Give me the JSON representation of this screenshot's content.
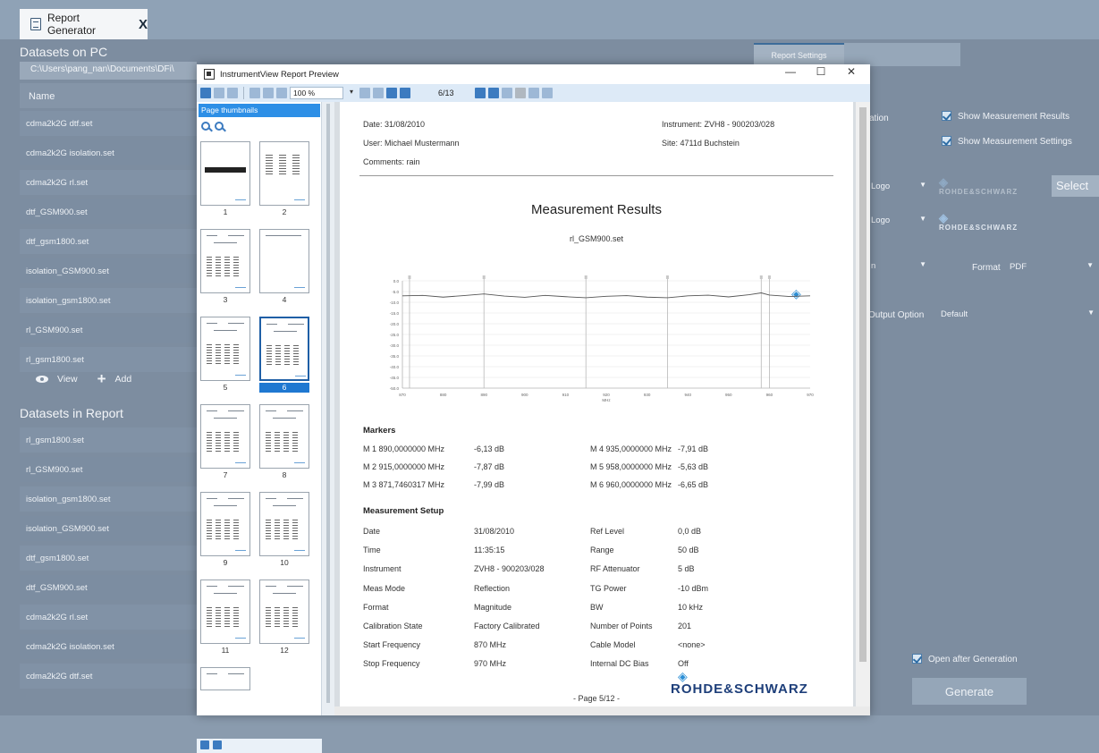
{
  "app": {
    "tab_title": "Report Generator",
    "tab_close": "X"
  },
  "left": {
    "datasets_pc_title": "Datasets on PC",
    "path": "C:\\Users\\pang_nan\\Documents\\DFi\\",
    "name_header": "Name",
    "pc_items": [
      "cdma2k2G dtf.set",
      "cdma2k2G isolation.set",
      "cdma2k2G rl.set",
      "dtf_GSM900.set",
      "dtf_gsm1800.set",
      "isolation_GSM900.set",
      "isolation_gsm1800.set",
      "rl_GSM900.set",
      "rl_gsm1800.set"
    ],
    "view_label": "View",
    "add_label": "Add",
    "datasets_report_title": "Datasets in Report",
    "report_items": [
      "rl_gsm1800.set",
      "rl_GSM900.set",
      "isolation_gsm1800.set",
      "isolation_GSM900.set",
      "dtf_gsm1800.set",
      "dtf_GSM900.set",
      "cdma2k2G rl.set",
      "cdma2k2G isolation.set",
      "cdma2k2G dtf.set"
    ]
  },
  "right": {
    "tab_label": "Report Settings",
    "partial_label": "ation",
    "show_results": "Show Measurement Results",
    "show_settings": "Show Measurement Settings",
    "logo_select_1": "Logo",
    "logo_select_2": "Logo",
    "select_button": "Select",
    "select_3": "n",
    "format_label": "Format",
    "format_value": "PDF",
    "output_option_label": "Output Option",
    "output_option_value": "Default",
    "open_after": "Open after Generation",
    "generate": "Generate",
    "rs_logo_text": "ROHDE&SCHWARZ"
  },
  "dialog": {
    "title": "InstrumentView Report Preview",
    "min": "—",
    "max": "☐",
    "close": "✕",
    "zoom": "100 %",
    "page_counter": "6/13",
    "thumb_header": "Page thumbnails",
    "thumb_numbers": [
      "1",
      "2",
      "3",
      "4",
      "5",
      "6",
      "7",
      "8",
      "9",
      "10",
      "11",
      "12"
    ]
  },
  "page": {
    "date": "Date: 31/08/2010",
    "user": "User: Michael Mustermann",
    "comments": "Comments: rain",
    "instrument": "Instrument: ZVH8 - 900203/028",
    "site": "Site: 4711d Buchstein",
    "title": "Measurement Results",
    "subtitle": "rl_GSM900.set",
    "markers_title": "Markers",
    "markers": [
      [
        "M 1 890,0000000 MHz",
        "-6,13 dB",
        "M 4 935,0000000 MHz",
        "-7,91 dB"
      ],
      [
        "M 2 915,0000000 MHz",
        "-7,87 dB",
        "M 5 958,0000000 MHz",
        "-5,63 dB"
      ],
      [
        "M 3 871,7460317 MHz",
        "-7,99 dB",
        "M 6 960,0000000 MHz",
        "-6,65 dB"
      ]
    ],
    "setup_title": "Measurement Setup",
    "setup": [
      [
        "Date",
        "31/08/2010",
        "Ref Level",
        "0,0 dB"
      ],
      [
        "Time",
        "11:35:15",
        "Range",
        "50 dB"
      ],
      [
        "Instrument",
        "ZVH8 - 900203/028",
        "RF Attenuator",
        "5 dB"
      ],
      [
        "Meas Mode",
        "Reflection",
        "TG Power",
        "-10 dBm"
      ],
      [
        "Format",
        "Magnitude",
        "BW",
        "10 kHz"
      ],
      [
        "Calibration State",
        "Factory Calibrated",
        "Number of Points",
        "201"
      ],
      [
        "Start Frequency",
        "870 MHz",
        "Cable Model",
        "<none>"
      ],
      [
        "Stop Frequency",
        "970 MHz",
        "Internal DC Bias",
        "Off"
      ]
    ],
    "footer": "- Page 5/12 -",
    "footer_logo": "ROHDE&SCHWARZ"
  },
  "chart_data": {
    "type": "line",
    "title": "",
    "xlabel": "MHz",
    "ylabel": "",
    "xlim": [
      870,
      970
    ],
    "ylim": [
      -50,
      0
    ],
    "x": [
      870,
      875,
      880,
      885,
      890,
      895,
      900,
      905,
      910,
      915,
      920,
      925,
      930,
      935,
      940,
      945,
      950,
      955,
      958,
      960,
      965,
      970
    ],
    "series": [
      {
        "values": [
          -7,
          -6.8,
          -7.6,
          -6.9,
          -6.13,
          -7.1,
          -7.7,
          -6.8,
          -7.4,
          -7.87,
          -7.2,
          -6.9,
          -7.6,
          -7.91,
          -7.0,
          -6.7,
          -7.5,
          -6.5,
          -5.63,
          -6.65,
          -7.3,
          -7.0
        ]
      }
    ],
    "marker_x": [
      871.7460317,
      890,
      915,
      935,
      958,
      960
    ],
    "x_ticks": [
      "870",
      "880",
      "890",
      "900",
      "910",
      "920",
      "930",
      "940",
      "950",
      "960",
      "970"
    ],
    "y_ticks": [
      "0.0",
      "-5.0",
      "-10.0",
      "-15.0",
      "-20.0",
      "-25.0",
      "-30.0",
      "-35.0",
      "-40.0",
      "-45.0",
      "-50.0"
    ]
  }
}
